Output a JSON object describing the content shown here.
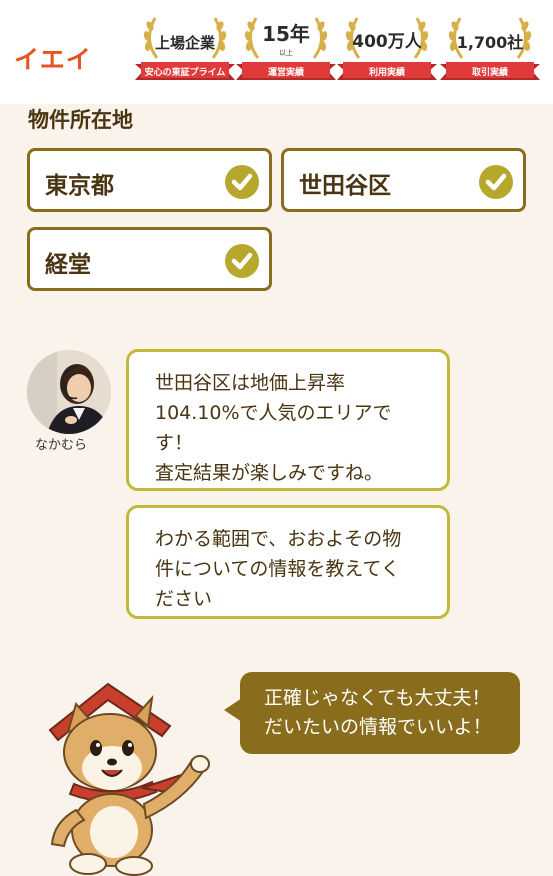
{
  "header": {
    "logo": "イエイ",
    "badges": [
      {
        "main": "上場企業",
        "sub": "",
        "ribbon": "安心の東証プライム"
      },
      {
        "main": "15年",
        "sub": "以上",
        "ribbon": "運営実績"
      },
      {
        "main": "400万人",
        "sub": "",
        "ribbon": "利用実績"
      },
      {
        "main": "1,700社",
        "sub": "",
        "ribbon": "取引実績"
      }
    ]
  },
  "section": {
    "title": "物件所在地"
  },
  "locations": [
    {
      "label": "東京都",
      "selected": true
    },
    {
      "label": "世田谷区",
      "selected": true
    },
    {
      "label": "経堂",
      "selected": true
    }
  ],
  "agent": {
    "name": "なかむら",
    "messages": [
      {
        "lines": [
          "世田谷区は地価上昇率",
          "104.10%で人気のエリアで",
          "す！",
          "査定結果が楽しみですね。"
        ]
      },
      {
        "lines": [
          "わかる範囲で、おおよその物",
          "件についての情報を教えてく",
          "ださい"
        ]
      }
    ]
  },
  "mascot": {
    "lines": [
      "正確じゃなくても大丈夫！",
      "だいたいの情報でいいよ！"
    ]
  },
  "colors": {
    "brand_orange": "#e8541f",
    "border_brown": "#8a6d1c",
    "check_olive": "#b5a82c",
    "bubble_border": "#c2b93a",
    "ribbon_red": "#e03a3a",
    "laurel_gold": "#d8b04a",
    "background": "#faf3ec"
  }
}
